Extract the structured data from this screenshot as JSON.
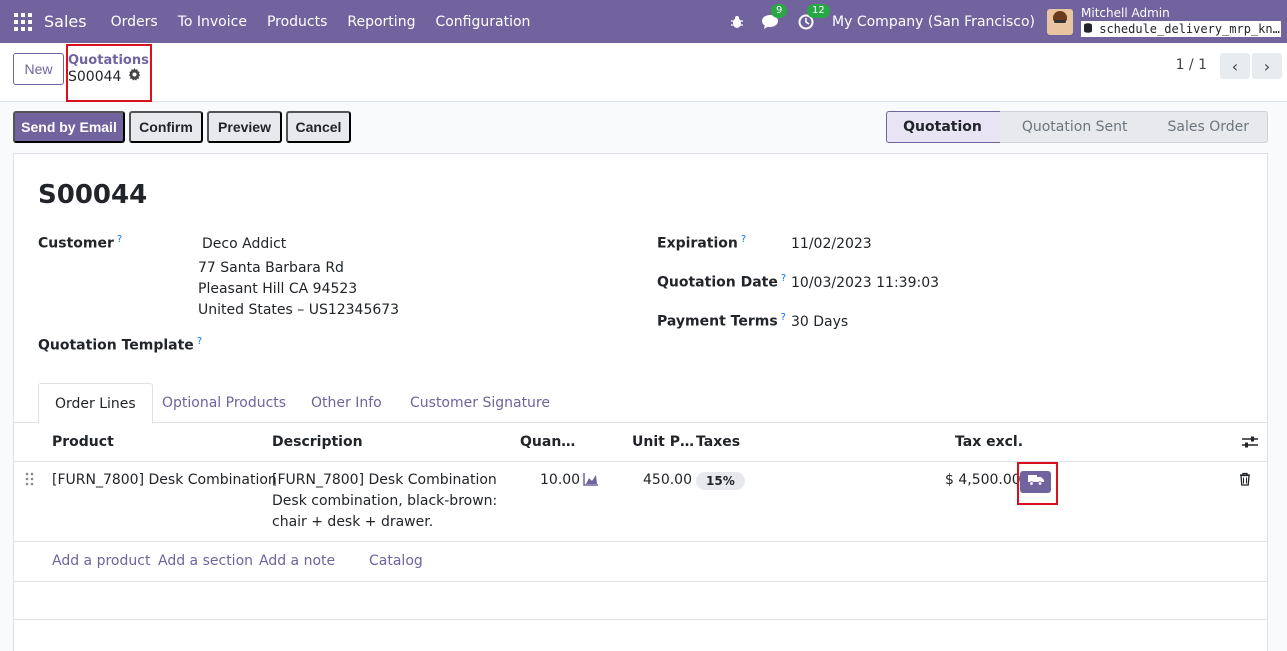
{
  "nav": {
    "app_name": "Sales",
    "menu": [
      "Orders",
      "To Invoice",
      "Products",
      "Reporting",
      "Configuration"
    ],
    "chat_badge": "9",
    "activity_badge": "12",
    "company": "My Company (San Francisco)",
    "user_name": "Mitchell Admin",
    "database": "schedule_delivery_mrp_kn…"
  },
  "control_panel": {
    "new_label": "New",
    "breadcrumb_parent": "Quotations",
    "breadcrumb_current": "S00044",
    "pager": "1 / 1"
  },
  "actions": {
    "send_by_email": "Send by Email",
    "confirm": "Confirm",
    "preview": "Preview",
    "cancel": "Cancel"
  },
  "statusbar": [
    "Quotation",
    "Quotation Sent",
    "Sales Order"
  ],
  "form": {
    "title": "S00044",
    "customer_label": "Customer",
    "customer_name": "Deco Addict",
    "customer_address": [
      "77 Santa Barbara Rd",
      "Pleasant Hill CA 94523",
      "United States – US12345673"
    ],
    "template_label": "Quotation Template",
    "expiration_label": "Expiration",
    "expiration_value": "11/02/2023",
    "quotation_date_label": "Quotation Date",
    "quotation_date_value": "10/03/2023 11:39:03",
    "payment_terms_label": "Payment Terms",
    "payment_terms_value": "30 Days",
    "help_mark": "?"
  },
  "tabs": [
    "Order Lines",
    "Optional Products",
    "Other Info",
    "Customer Signature"
  ],
  "order_lines": {
    "columns": [
      "Product",
      "Description",
      "Quan…",
      "Unit P…",
      "Taxes",
      "Tax excl."
    ],
    "rows": [
      {
        "product": "[FURN_7800] Desk Combination",
        "description": [
          "[FURN_7800] Desk Combination",
          "Desk combination, black-brown:",
          "chair + desk + drawer."
        ],
        "quantity": "10.00",
        "unit_price": "450.00",
        "taxes": "15%",
        "subtotal": "$ 4,500.00"
      }
    ],
    "add_links": [
      "Add a product",
      "Add a section",
      "Add a note",
      "Catalog"
    ]
  },
  "colors": {
    "brand": "#71639e",
    "highlight": "#d9111f",
    "badge": "#28a745"
  }
}
